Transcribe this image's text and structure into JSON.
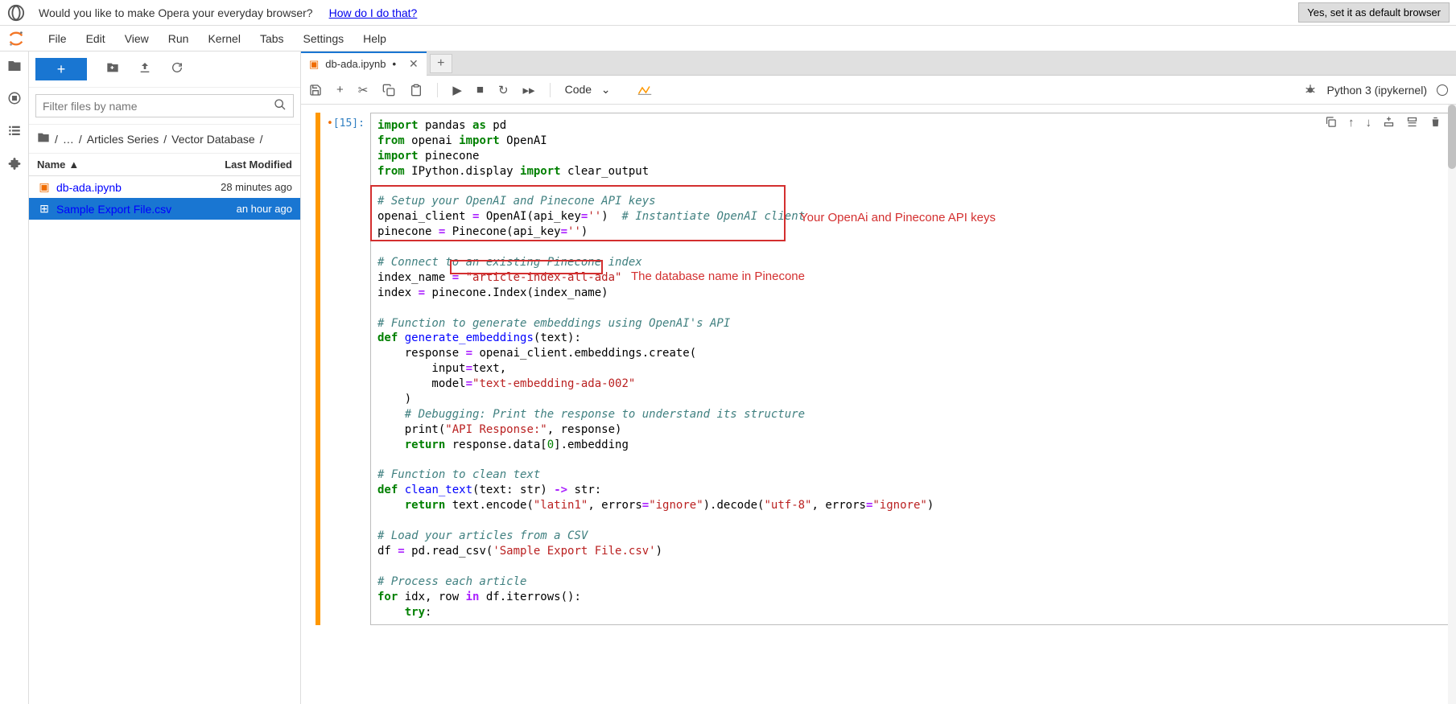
{
  "opera": {
    "prompt": "Would you like to make Opera your everyday browser?",
    "link": "How do I do that?",
    "button": "Yes, set it as default browser"
  },
  "menu": {
    "items": [
      "File",
      "Edit",
      "View",
      "Run",
      "Kernel",
      "Tabs",
      "Settings",
      "Help"
    ]
  },
  "filebrowser": {
    "filter_placeholder": "Filter files by name",
    "breadcrumb": [
      "",
      "…",
      "Articles Series",
      "Vector Database",
      ""
    ],
    "header_name": "Name",
    "header_mod": "Last Modified",
    "files": [
      {
        "name": "db-ada.ipynb",
        "modified": "28 minutes ago",
        "type": "notebook",
        "selected": false
      },
      {
        "name": "Sample Export File.csv",
        "modified": "an hour ago",
        "type": "csv",
        "selected": true
      }
    ]
  },
  "tab": {
    "title": "db-ada.ipynb"
  },
  "toolbar": {
    "cell_type": "Code",
    "kernel": "Python 3 (ipykernel)"
  },
  "cell": {
    "prompt": "[15]:",
    "tokens": [
      {
        "t": "kw",
        "v": "import"
      },
      {
        "t": "nm",
        "v": " pandas "
      },
      {
        "t": "kw",
        "v": "as"
      },
      {
        "t": "nm",
        "v": " pd\n"
      },
      {
        "t": "kw",
        "v": "from"
      },
      {
        "t": "nm",
        "v": " openai "
      },
      {
        "t": "kw",
        "v": "import"
      },
      {
        "t": "nm",
        "v": " OpenAI\n"
      },
      {
        "t": "kw",
        "v": "import"
      },
      {
        "t": "nm",
        "v": " pinecone\n"
      },
      {
        "t": "kw",
        "v": "from"
      },
      {
        "t": "nm",
        "v": " IPython.display "
      },
      {
        "t": "kw",
        "v": "import"
      },
      {
        "t": "nm",
        "v": " clear_output\n\n"
      },
      {
        "t": "cm",
        "v": "# Setup your OpenAI and Pinecone API keys"
      },
      {
        "t": "nm",
        "v": "\n"
      },
      {
        "t": "nm",
        "v": "openai_client "
      },
      {
        "t": "op",
        "v": "="
      },
      {
        "t": "nm",
        "v": " OpenAI(api_key"
      },
      {
        "t": "op",
        "v": "="
      },
      {
        "t": "str",
        "v": "''"
      },
      {
        "t": "nm",
        "v": ")  "
      },
      {
        "t": "cm",
        "v": "# Instantiate OpenAI client"
      },
      {
        "t": "nm",
        "v": "\n"
      },
      {
        "t": "nm",
        "v": "pinecone "
      },
      {
        "t": "op",
        "v": "="
      },
      {
        "t": "nm",
        "v": " Pinecone(api_key"
      },
      {
        "t": "op",
        "v": "="
      },
      {
        "t": "str",
        "v": "''"
      },
      {
        "t": "nm",
        "v": ")\n\n"
      },
      {
        "t": "cm",
        "v": "# Connect to an existing Pinecone index"
      },
      {
        "t": "nm",
        "v": "\n"
      },
      {
        "t": "nm",
        "v": "index_name "
      },
      {
        "t": "op",
        "v": "="
      },
      {
        "t": "nm",
        "v": " "
      },
      {
        "t": "str",
        "v": "\"article-index-all-ada\""
      },
      {
        "t": "nm",
        "v": "\n"
      },
      {
        "t": "nm",
        "v": "index "
      },
      {
        "t": "op",
        "v": "="
      },
      {
        "t": "nm",
        "v": " pinecone.Index(index_name)\n\n"
      },
      {
        "t": "cm",
        "v": "# Function to generate embeddings using OpenAI's API"
      },
      {
        "t": "nm",
        "v": "\n"
      },
      {
        "t": "kw",
        "v": "def"
      },
      {
        "t": "nm",
        "v": " "
      },
      {
        "t": "fn",
        "v": "generate_embeddings"
      },
      {
        "t": "nm",
        "v": "(text):\n"
      },
      {
        "t": "nm",
        "v": "    response "
      },
      {
        "t": "op",
        "v": "="
      },
      {
        "t": "nm",
        "v": " openai_client.embeddings.create(\n"
      },
      {
        "t": "nm",
        "v": "        input"
      },
      {
        "t": "op",
        "v": "="
      },
      {
        "t": "nm",
        "v": "text,\n"
      },
      {
        "t": "nm",
        "v": "        model"
      },
      {
        "t": "op",
        "v": "="
      },
      {
        "t": "str",
        "v": "\"text-embedding-ada-002\""
      },
      {
        "t": "nm",
        "v": "\n"
      },
      {
        "t": "nm",
        "v": "    )\n"
      },
      {
        "t": "nm",
        "v": "    "
      },
      {
        "t": "cm",
        "v": "# Debugging: Print the response to understand its structure"
      },
      {
        "t": "nm",
        "v": "\n"
      },
      {
        "t": "nm",
        "v": "    print("
      },
      {
        "t": "str",
        "v": "\"API Response:\""
      },
      {
        "t": "nm",
        "v": ", response)\n"
      },
      {
        "t": "nm",
        "v": "    "
      },
      {
        "t": "kw",
        "v": "return"
      },
      {
        "t": "nm",
        "v": " response.data["
      },
      {
        "t": "num",
        "v": "0"
      },
      {
        "t": "nm",
        "v": "].embedding\n\n"
      },
      {
        "t": "cm",
        "v": "# Function to clean text"
      },
      {
        "t": "nm",
        "v": "\n"
      },
      {
        "t": "kw",
        "v": "def"
      },
      {
        "t": "nm",
        "v": " "
      },
      {
        "t": "fn",
        "v": "clean_text"
      },
      {
        "t": "nm",
        "v": "(text: str) "
      },
      {
        "t": "op",
        "v": "->"
      },
      {
        "t": "nm",
        "v": " str:\n"
      },
      {
        "t": "nm",
        "v": "    "
      },
      {
        "t": "kw",
        "v": "return"
      },
      {
        "t": "nm",
        "v": " text.encode("
      },
      {
        "t": "str",
        "v": "\"latin1\""
      },
      {
        "t": "nm",
        "v": ", errors"
      },
      {
        "t": "op",
        "v": "="
      },
      {
        "t": "str",
        "v": "\"ignore\""
      },
      {
        "t": "nm",
        "v": ").decode("
      },
      {
        "t": "str",
        "v": "\"utf-8\""
      },
      {
        "t": "nm",
        "v": ", errors"
      },
      {
        "t": "op",
        "v": "="
      },
      {
        "t": "str",
        "v": "\"ignore\""
      },
      {
        "t": "nm",
        "v": ")\n\n"
      },
      {
        "t": "cm",
        "v": "# Load your articles from a CSV"
      },
      {
        "t": "nm",
        "v": "\n"
      },
      {
        "t": "nm",
        "v": "df "
      },
      {
        "t": "op",
        "v": "="
      },
      {
        "t": "nm",
        "v": " pd.read_csv("
      },
      {
        "t": "str",
        "v": "'Sample Export File.csv'"
      },
      {
        "t": "nm",
        "v": ")\n\n"
      },
      {
        "t": "cm",
        "v": "# Process each article"
      },
      {
        "t": "nm",
        "v": "\n"
      },
      {
        "t": "kw",
        "v": "for"
      },
      {
        "t": "nm",
        "v": " idx, row "
      },
      {
        "t": "op",
        "v": "in"
      },
      {
        "t": "nm",
        "v": " df.iterrows():\n"
      },
      {
        "t": "nm",
        "v": "    "
      },
      {
        "t": "kw",
        "v": "try"
      },
      {
        "t": "nm",
        "v": ":"
      }
    ]
  },
  "annotations": {
    "a1": "Your OpenAi and Pinecone API keys",
    "a2": "The database name in Pinecone"
  }
}
